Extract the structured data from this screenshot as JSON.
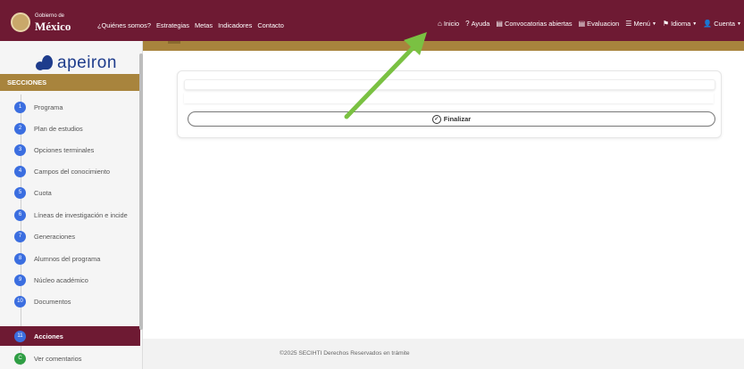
{
  "topbar": {
    "gov_small": "Gobierno de",
    "gov_big": "México",
    "left_links": [
      "¿Quiénes somos?",
      "Estrategias",
      "Metas",
      "Indicadores",
      "Contacto"
    ],
    "right_links": [
      {
        "icon": "home-icon",
        "label": "Inicio"
      },
      {
        "icon": "help-icon",
        "label": "Ayuda"
      },
      {
        "icon": "document-icon",
        "label": "Convocatorias abiertas"
      },
      {
        "icon": "document-icon",
        "label": "Evaluacion"
      },
      {
        "icon": "menu-icon",
        "label": "Menú"
      },
      {
        "icon": "flag-icon",
        "label": "Idioma"
      },
      {
        "icon": "user-icon",
        "label": "Cuenta"
      }
    ]
  },
  "sidebar": {
    "logo_text": "apeiron",
    "section_header": "SECCIONES",
    "items": [
      {
        "num": "1",
        "label": "Programa"
      },
      {
        "num": "2",
        "label": "Plan de estudios"
      },
      {
        "num": "3",
        "label": "Opciones terminales"
      },
      {
        "num": "4",
        "label": "Campos del conocimiento"
      },
      {
        "num": "5",
        "label": "Cuota"
      },
      {
        "num": "6",
        "label": "Líneas de investigación e incide"
      },
      {
        "num": "7",
        "label": "Generaciones"
      },
      {
        "num": "8",
        "label": "Alumnos del programa"
      },
      {
        "num": "9",
        "label": "Núcleo académico"
      },
      {
        "num": "10",
        "label": "Documentos"
      },
      {
        "num": "11",
        "label": "Acciones"
      },
      {
        "num": "C",
        "label": "Ver comentarios"
      }
    ]
  },
  "main": {
    "finalize_label": "Finalizar"
  },
  "footer": {
    "text": "©2025 SECIHTI Derechos Reservados en trámite"
  },
  "colors": {
    "primary": "#6e1a33",
    "gold": "#a8843d",
    "step_blue": "#3b6ee0",
    "step_green": "#2f9e44",
    "annotation_arrow": "#7ac142"
  }
}
